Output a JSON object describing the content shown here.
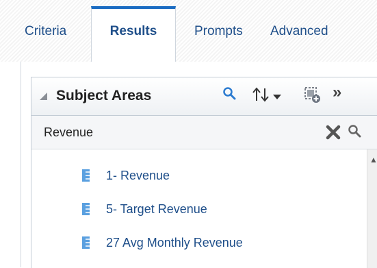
{
  "tabs": [
    {
      "label": "Criteria",
      "active": false
    },
    {
      "label": "Results",
      "active": true
    },
    {
      "label": "Prompts",
      "active": false
    },
    {
      "label": "Advanced",
      "active": false
    }
  ],
  "panel": {
    "title": "Subject Areas",
    "toolbar": {
      "search_icon": "search-icon",
      "sort_icon": "sort-icon",
      "add_icon": "add-icon",
      "more_label": "»"
    }
  },
  "search": {
    "value": "Revenue",
    "placeholder": ""
  },
  "results": [
    {
      "label": "1- Revenue",
      "icon": "measure-column-icon"
    },
    {
      "label": "5- Target Revenue",
      "icon": "measure-column-icon"
    },
    {
      "label": "27 Avg Monthly Revenue",
      "icon": "measure-column-icon"
    }
  ],
  "colors": {
    "accent": "#1b6cc2",
    "link": "#1f4f8a",
    "measure_icon": "#5aa0e0"
  }
}
